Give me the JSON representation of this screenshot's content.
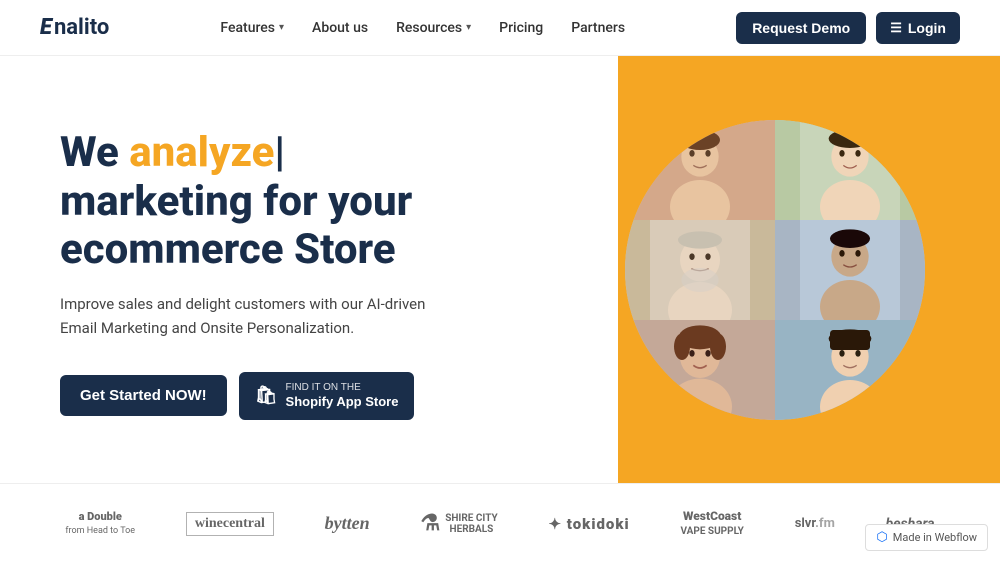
{
  "nav": {
    "logo_text": "nalito",
    "logo_prefix": "E",
    "links": [
      {
        "label": "Features",
        "has_dropdown": true
      },
      {
        "label": "About us",
        "has_dropdown": false
      },
      {
        "label": "Resources",
        "has_dropdown": true
      },
      {
        "label": "Pricing",
        "has_dropdown": false
      },
      {
        "label": "Partners",
        "has_dropdown": false
      }
    ],
    "request_demo_label": "Request Demo",
    "login_label": "Login"
  },
  "hero": {
    "title_prefix": "We ",
    "title_highlight": "analyze",
    "title_separator": "|",
    "title_rest1": "marketing for your",
    "title_rest2": "ecommerce Store",
    "subtitle": "Improve sales and delight customers with our AI-driven Email Marketing and Onsite Personalization.",
    "cta_primary": "Get Started NOW!",
    "cta_shopify_small": "FIND IT ON THE",
    "cta_shopify_main": "Shopify App Store"
  },
  "logos": [
    {
      "label": "a Double",
      "sub": "from Head to Toe"
    },
    {
      "label": "winecentral"
    },
    {
      "label": "bytten"
    },
    {
      "label": "Shire City Herbals"
    },
    {
      "label": "tokidoki"
    },
    {
      "label": "WestCoast Vape Supply"
    },
    {
      "label": "slvr.fm"
    },
    {
      "label": "beshara"
    }
  ],
  "webflow_badge": {
    "text": "Made in Webflow"
  }
}
